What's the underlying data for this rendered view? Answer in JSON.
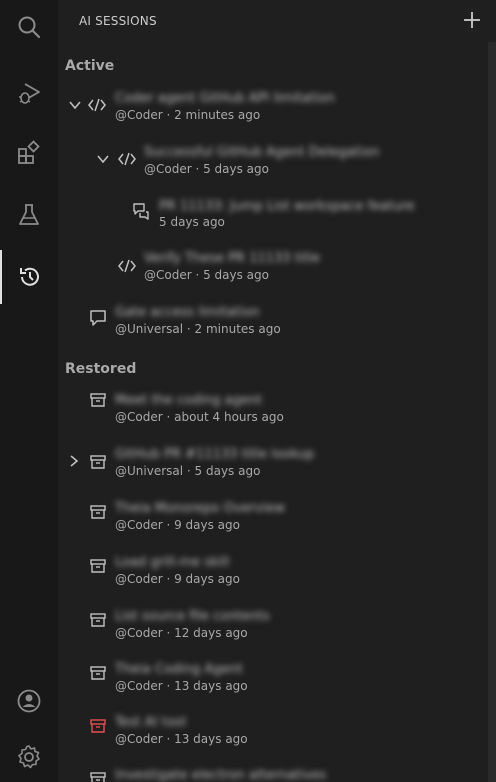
{
  "header": {
    "title": "AI SESSIONS"
  },
  "sections": {
    "active": "Active",
    "restored": "Restored"
  },
  "active_sessions": [
    {
      "title": "Coder agent GitHub API limitation",
      "sub": "@Coder · 2 minutes ago",
      "icon": "code-icon",
      "expanded": true
    },
    {
      "title": "Successful GitHub Agent Delegation",
      "sub": "@Coder · 5 days ago",
      "icon": "code-icon",
      "expanded": true
    },
    {
      "title": "PR 11133: Jump List workspace feature",
      "sub": "5 days ago",
      "icon": "chat-comment-icon"
    },
    {
      "title": "Verify These PR 11133 title",
      "sub": "@Coder · 5 days ago",
      "icon": "code-icon"
    },
    {
      "title": "Gate access limitation",
      "sub": "@Universal · 2 minutes ago",
      "icon": "chat-icon"
    }
  ],
  "restored_sessions": [
    {
      "title": "Meet the coding agent",
      "sub": "@Coder · about 4 hours ago",
      "icon": "archive-icon"
    },
    {
      "title": "GitHub PR #11133 title lookup",
      "sub": "@Universal · 5 days ago",
      "icon": "archive-icon",
      "collapsed": true
    },
    {
      "title": "Theia Monorepo Overview",
      "sub": "@Coder · 9 days ago",
      "icon": "archive-icon"
    },
    {
      "title": "Load grill-me skill",
      "sub": "@Coder · 9 days ago",
      "icon": "archive-icon"
    },
    {
      "title": "List source file contents",
      "sub": "@Coder · 12 days ago",
      "icon": "archive-icon"
    },
    {
      "title": "Theia Coding Agent",
      "sub": "@Coder · 13 days ago",
      "icon": "archive-icon"
    },
    {
      "title": "Test AI tool",
      "sub": "@Coder · 13 days ago",
      "icon": "archive-icon",
      "accent": "#e05252"
    },
    {
      "title": "Investigate electron alternatives",
      "sub": "",
      "icon": "archive-icon"
    }
  ],
  "colors": {
    "accent_red": "#e05252",
    "activity_bg": "#181818",
    "sidebar_bg": "#1f1f1f"
  }
}
